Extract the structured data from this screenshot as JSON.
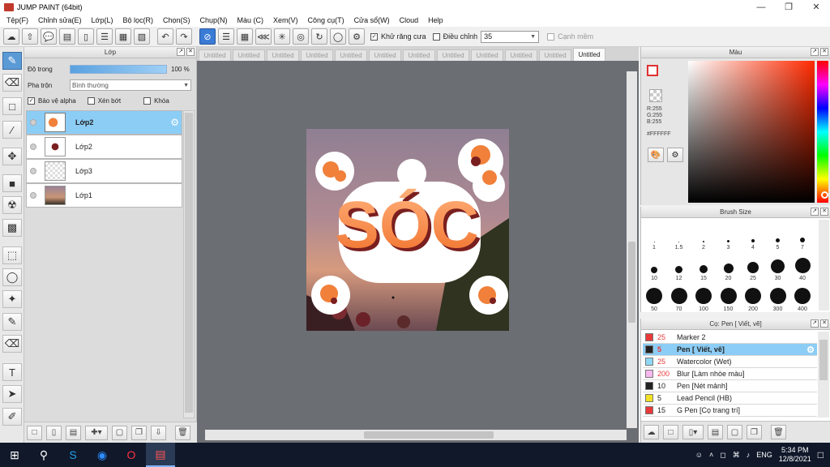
{
  "window": {
    "title": "JUMP PAINT (64bit)"
  },
  "menu": [
    "Tệp(F)",
    "Chỉnh sửa(E)",
    "Lớp(L)",
    "Bộ lọc(R)",
    "Chọn(S)",
    "Chụp(N)",
    "Màu (C)",
    "Xem(V)",
    "Công cụ(T)",
    "Cửa sổ(W)",
    "Cloud",
    "Help"
  ],
  "toolbar": {
    "antialias_label": "Khử răng cưa",
    "adjust_label": "Điều chỉnh",
    "adjust_value": "35",
    "smooth_label": "Cạnh mềm"
  },
  "layer_panel": {
    "title": "Lớp",
    "opacity_label": "Độ trong",
    "opacity_value": "100 %",
    "blend_label": "Pha trộn",
    "blend_value": "Bình thường",
    "protect_alpha": "Bảo vệ alpha",
    "clip": "Xén bớt",
    "lock": "Khóa",
    "layers": [
      {
        "name": "Lớp2",
        "selected": true
      },
      {
        "name": "Lớp2",
        "selected": false
      },
      {
        "name": "Lớp3",
        "selected": false
      },
      {
        "name": "Lớp1",
        "selected": false
      }
    ]
  },
  "tabs": [
    "Untitled",
    "Untitled",
    "Untitled",
    "Untitled",
    "Untitled",
    "Untitled",
    "Untitled",
    "Untitled",
    "Untitled",
    "Untitled",
    "Untitled",
    "Untitled"
  ],
  "color_panel": {
    "title": "Màu",
    "r": "R:255",
    "g": "G:255",
    "b": "B:255",
    "hex": "#FFFFFF"
  },
  "brush_size": {
    "title": "Brush Size",
    "sizes": [
      "1",
      "1.5",
      "2",
      "3",
      "4",
      "5",
      "7",
      "10",
      "12",
      "15",
      "20",
      "25",
      "30",
      "40",
      "50",
      "70",
      "100",
      "150",
      "200",
      "300",
      "400"
    ]
  },
  "brush_list": {
    "title": "Cọ: Pen [ Viết, vẽ]",
    "items": [
      {
        "size": "25",
        "name": "Marker 2",
        "color": "#e83a3a"
      },
      {
        "size": "5",
        "name": "Pen [ Viết, vẽ]",
        "color": "#222222"
      },
      {
        "size": "25",
        "name": "Watercolor (Wet)",
        "color": "#8fd8f5"
      },
      {
        "size": "200",
        "name": "Blur [Làm nhòe màu]",
        "color": "#f6b8ee"
      },
      {
        "size": "10",
        "name": "Pen [Nét mảnh]",
        "color": "#222222"
      },
      {
        "size": "5",
        "name": "Lead Pencil (HB)",
        "color": "#f2e024"
      },
      {
        "size": "15",
        "name": "G Pen [Cọ trang trí]",
        "color": "#e83a3a"
      }
    ]
  },
  "canvas": {
    "art_text": "SÓC"
  },
  "taskbar": {
    "lang": "ENG",
    "time": "5:34 PM",
    "date": "12/8/2021"
  },
  "colors": {
    "accent": "#3a7bd5",
    "selected_row": "#8ccdf5",
    "canvas_bg": "#6b6e73"
  }
}
